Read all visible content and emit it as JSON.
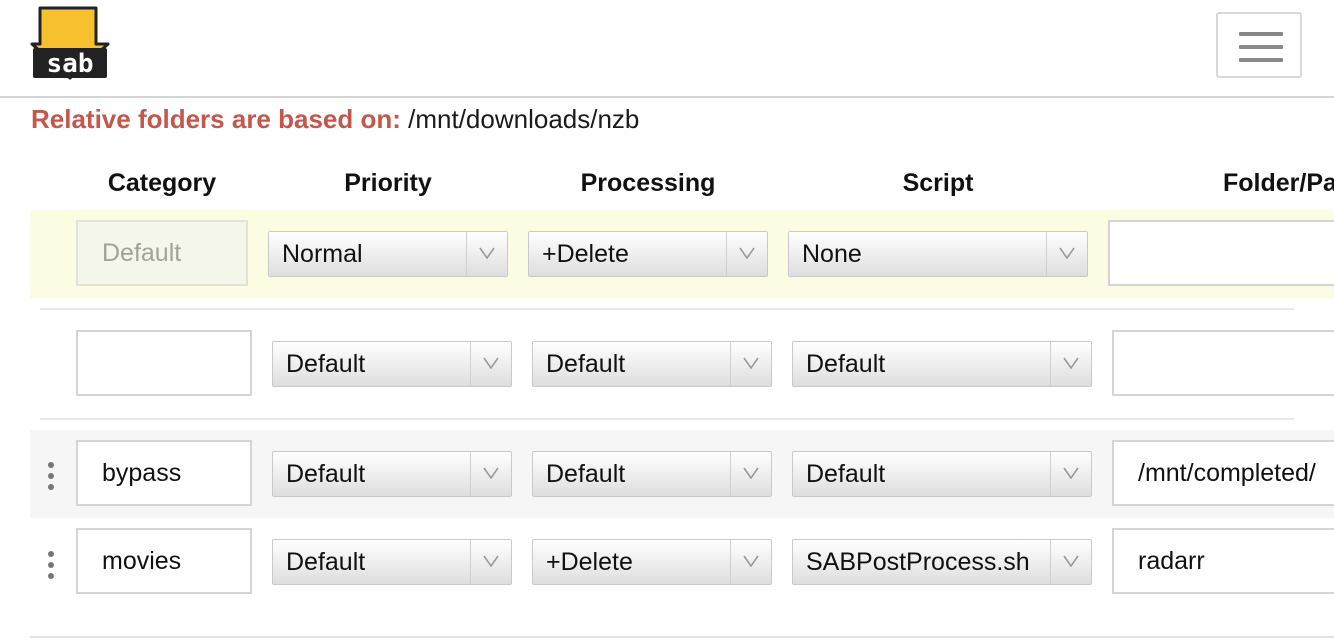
{
  "header": {
    "logo_text": "sab",
    "menu_button": "menu"
  },
  "relative_folders": {
    "label": "Relative folders are based on:",
    "path": "/mnt/downloads/nzb"
  },
  "columns": {
    "category": "Category",
    "priority": "Priority",
    "processing": "Processing",
    "script": "Script",
    "folder": "Folder/Pa"
  },
  "rows": [
    {
      "category": "Default",
      "category_editable": false,
      "priority": "Normal",
      "processing": "+Delete",
      "script": "None",
      "folder": ""
    },
    {
      "category": "",
      "category_editable": true,
      "priority": "Default",
      "processing": "Default",
      "script": "Default",
      "folder": ""
    },
    {
      "category": "bypass",
      "category_editable": true,
      "priority": "Default",
      "processing": "Default",
      "script": "Default",
      "folder": "/mnt/completed/"
    },
    {
      "category": "movies",
      "category_editable": true,
      "priority": "Default",
      "processing": "+Delete",
      "script": "SABPostProcess.sh",
      "folder": "radarr"
    }
  ],
  "colors": {
    "accent_label": "#c4574b",
    "default_row_bg": "#fcfce3",
    "logo_yellow": "#f7c02f"
  },
  "icons": {
    "dropdown_arrow": "chevron-down-icon",
    "drag_handle": "drag-handle-icon",
    "menu": "hamburger-icon"
  }
}
